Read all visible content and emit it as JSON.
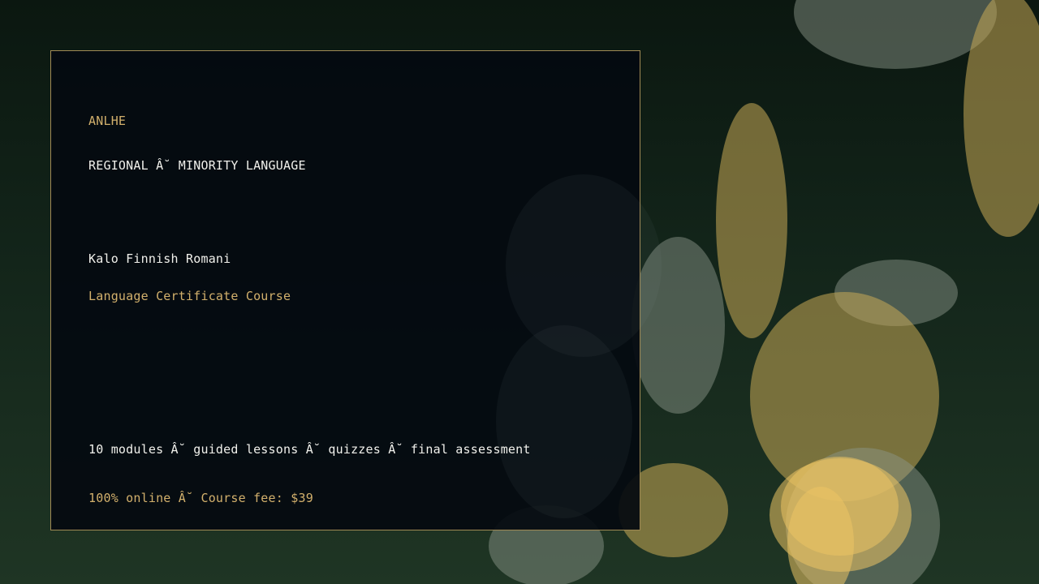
{
  "card": {
    "brand": "ANLHE",
    "category": "REGIONAL Â˘ MINORITY LANGUAGE",
    "language": "Kalo Finnish Romani",
    "course_type": "Language Certificate Course",
    "features": "10 modules Â˘ guided lessons Â˘ quizzes Â˘ final assessment",
    "pricing": "100% online Â˘ Course fee: $39"
  },
  "colors": {
    "accent_gold": "#d2b06c",
    "border_gold": "#a08a55",
    "text_white": "#f1f1ec",
    "card_bg": "#040a10",
    "background_green": "#13251a"
  }
}
